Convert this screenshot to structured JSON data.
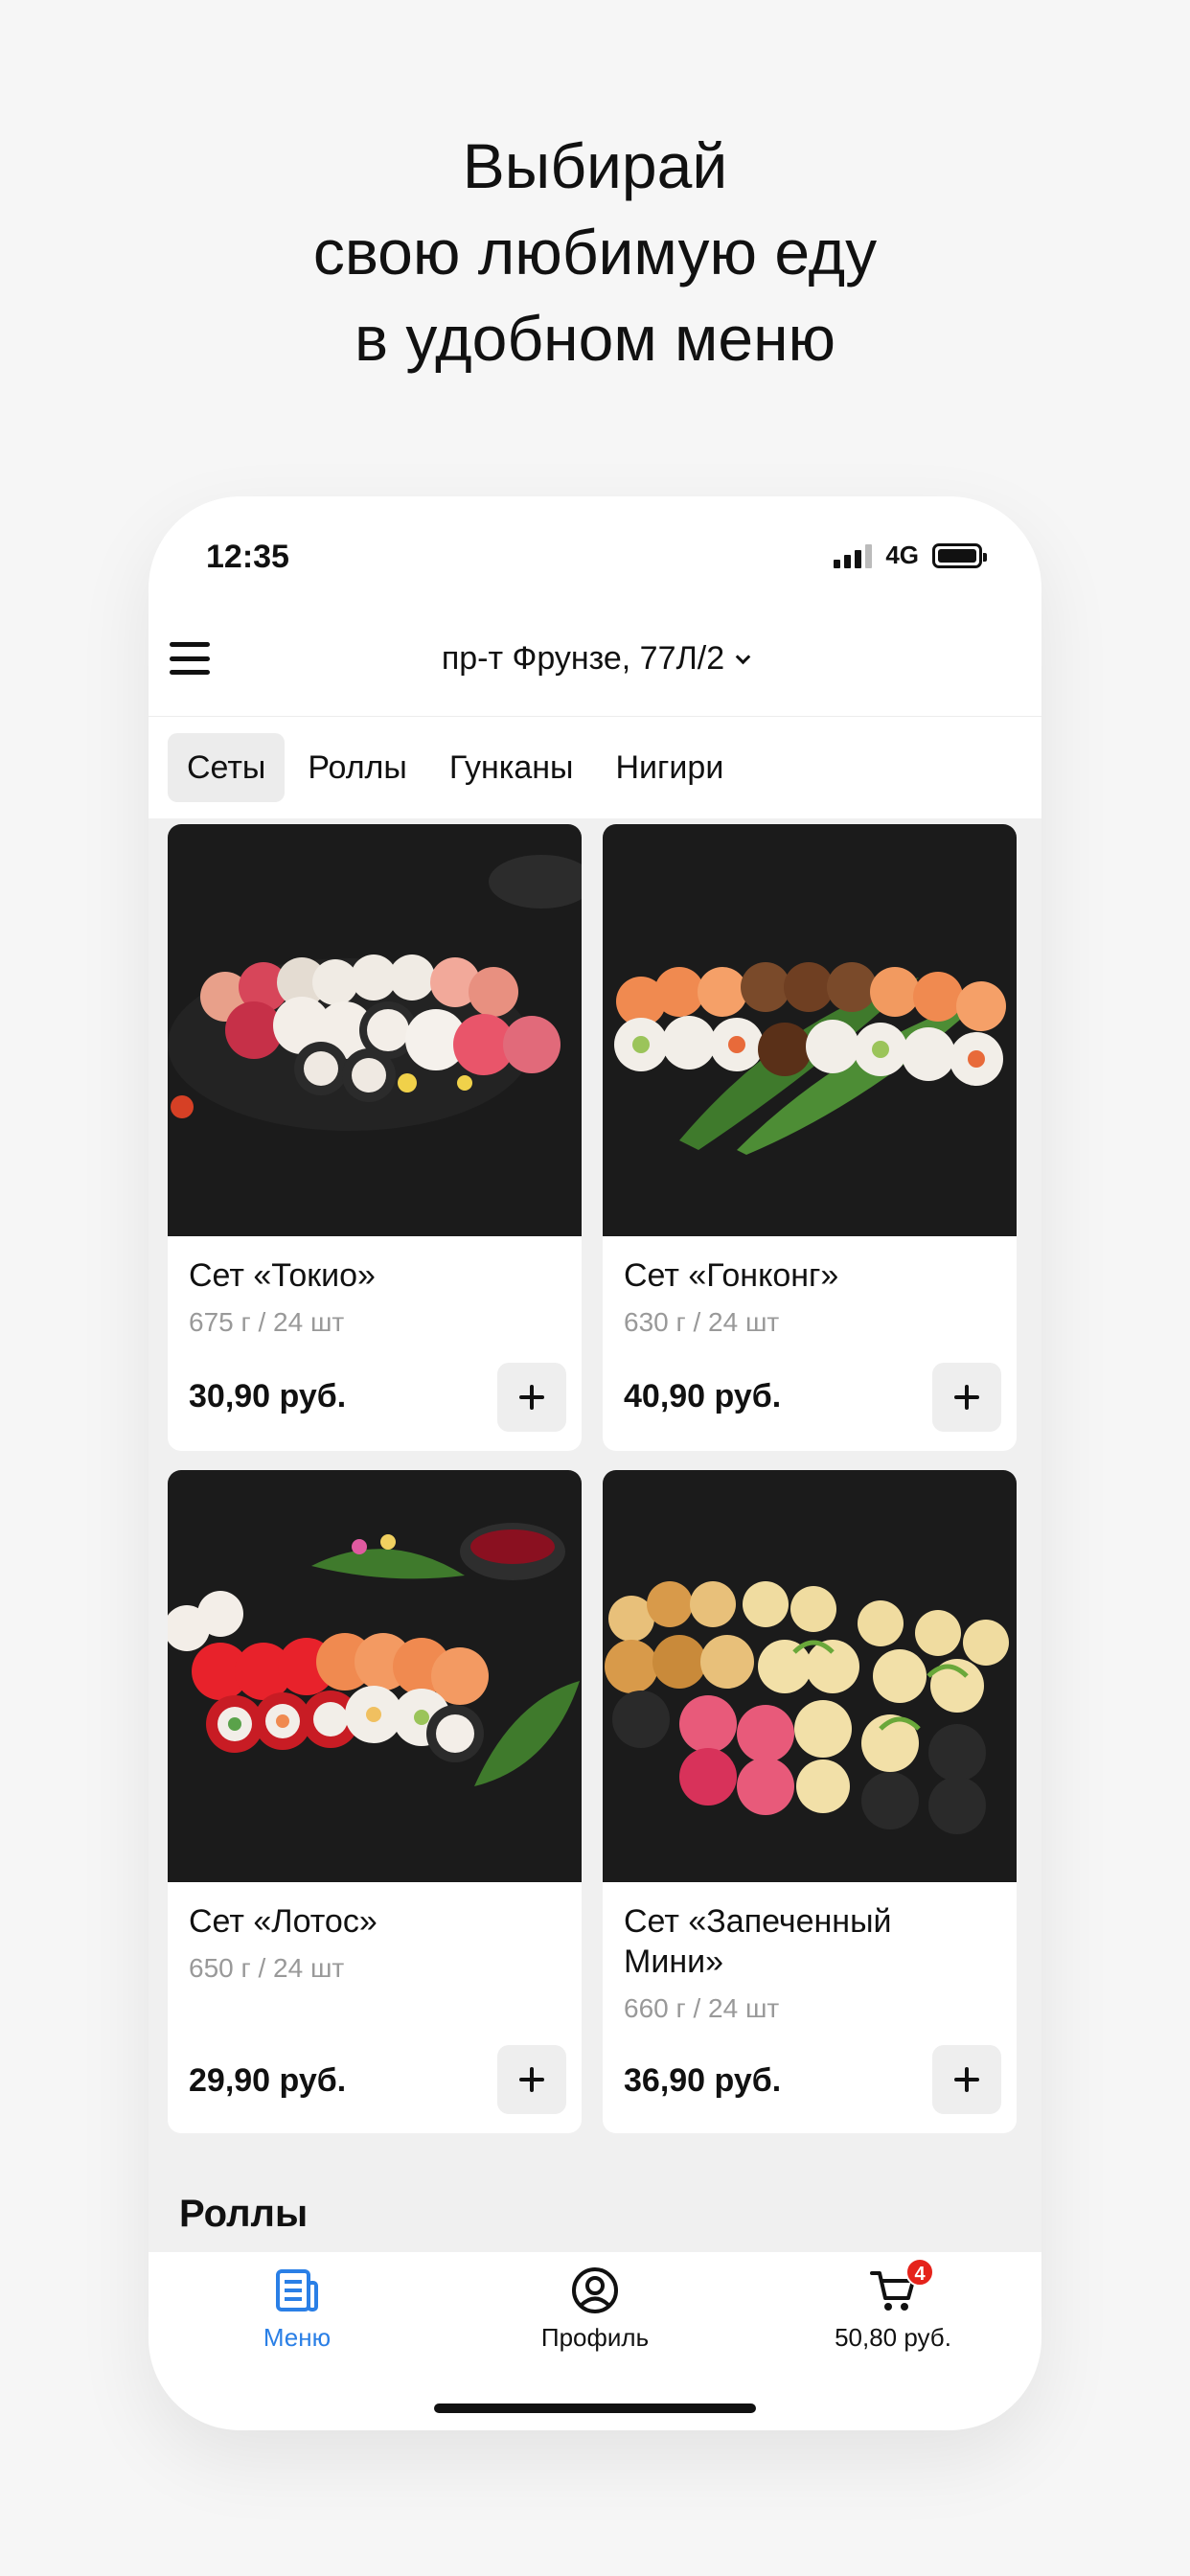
{
  "headline": {
    "line1": "Выбирай",
    "line2": "свою любимую еду",
    "line3": "в удобном меню"
  },
  "status_bar": {
    "time": "12:35",
    "network": "4G",
    "signal_icon": "signal-bars-icon",
    "battery_icon": "battery-icon"
  },
  "header": {
    "menu_icon": "hamburger-menu-icon",
    "address": "пр-т Фрунзе, 77Л/2",
    "address_icon": "chevron-down-icon"
  },
  "categories": [
    {
      "label": "Сеты",
      "active": true
    },
    {
      "label": "Роллы",
      "active": false
    },
    {
      "label": "Гунканы",
      "active": false
    },
    {
      "label": "Нигири",
      "active": false
    }
  ],
  "products": [
    {
      "name": "Сет «Токио»",
      "weight": "675 г / 24 шт",
      "price": "30,90 руб."
    },
    {
      "name": "Сет «Гонконг»",
      "weight": "630 г / 24 шт",
      "price": "40,90 руб."
    },
    {
      "name": "Сет «Лотос»",
      "weight": "650 г / 24 шт",
      "price": "29,90 руб."
    },
    {
      "name_line1": "Сет «Запеченный",
      "name_line2": "Мини»",
      "weight": "660 г / 24 шт",
      "price": "36,90 руб."
    }
  ],
  "section_next": "Роллы",
  "tabbar": {
    "menu": {
      "label": "Меню",
      "icon": "menu-document-icon",
      "active": true
    },
    "profile": {
      "label": "Профиль",
      "icon": "profile-icon"
    },
    "cart": {
      "label": "50,80 руб.",
      "icon": "cart-icon",
      "badge": "4"
    }
  },
  "colors": {
    "accent": "#2a7fe6",
    "badge": "#e5231b",
    "background": "#f6f6f6"
  }
}
